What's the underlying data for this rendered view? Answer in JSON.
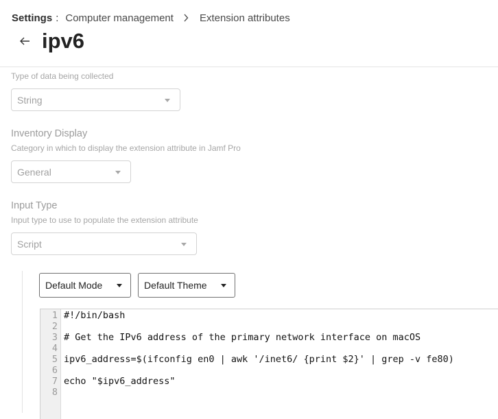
{
  "breadcrumb": {
    "root": "Settings",
    "separator": ":",
    "items": [
      "Computer management",
      "Extension attributes"
    ]
  },
  "page": {
    "title": "ipv6"
  },
  "data_type": {
    "description": "Type of data being collected",
    "value": "String"
  },
  "inventory_display": {
    "title": "Inventory Display",
    "description": "Category in which to display the extension attribute in Jamf Pro",
    "value": "General"
  },
  "input_type": {
    "title": "Input Type",
    "description": "Input type to use to populate the extension attribute",
    "value": "Script"
  },
  "editor": {
    "mode_label": "Default Mode",
    "theme_label": "Default Theme",
    "lines": [
      {
        "n": "1",
        "text": "#!/bin/bash"
      },
      {
        "n": "2",
        "text": ""
      },
      {
        "n": "3",
        "text": "# Get the IPv6 address of the primary network interface on macOS"
      },
      {
        "n": "4",
        "text": ""
      },
      {
        "n": "5",
        "text": "ipv6_address=$(ifconfig en0 | awk '/inet6/ {print $2}' | grep -v fe80)"
      },
      {
        "n": "6",
        "text": ""
      },
      {
        "n": "7",
        "text": "echo \"$ipv6_address\""
      },
      {
        "n": "8",
        "text": ""
      }
    ]
  },
  "colors": {
    "border": "#d3d3d3",
    "muted_text": "#a0a0a0",
    "gutter_bg": "#f0f0f0"
  }
}
